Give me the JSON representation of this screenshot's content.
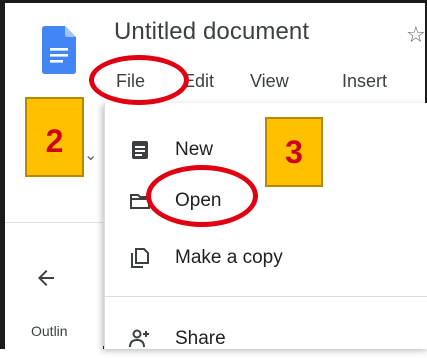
{
  "document": {
    "title": "Untitled document"
  },
  "menubar": {
    "items": [
      "File",
      "Edit",
      "View",
      "Insert"
    ]
  },
  "file_menu": {
    "items": [
      {
        "label": "New",
        "icon": "document-icon"
      },
      {
        "label": "Open",
        "icon": "folder-icon"
      },
      {
        "label": "Make a copy",
        "icon": "copy-icon"
      },
      {
        "label": "Share",
        "icon": "person-add-icon"
      }
    ]
  },
  "sidebar": {
    "outline_label": "Outlin"
  },
  "annotations": {
    "step_2": "2",
    "step_3": "3",
    "badge_color": "#ffc000",
    "badge_text_color": "#d0001b",
    "ring_color": "#e00012"
  },
  "colors": {
    "docs_blue": "#4285f4",
    "text": "#3c4043"
  }
}
